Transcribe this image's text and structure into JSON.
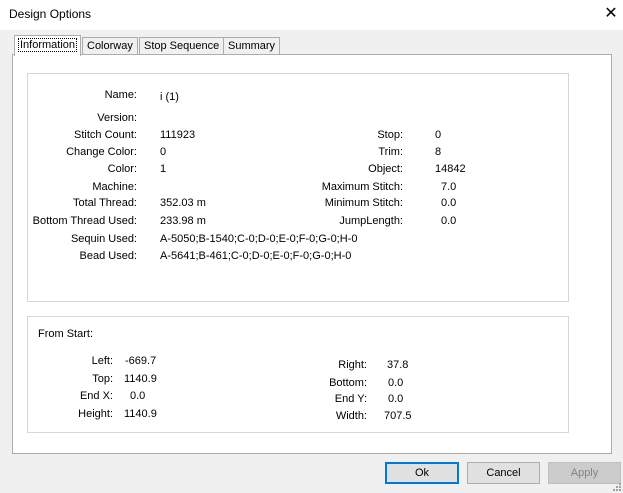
{
  "window": {
    "title": "Design Options"
  },
  "tabs": [
    "Information",
    "Colorway",
    "Stop Sequence",
    "Summary"
  ],
  "info": {
    "left": [
      {
        "label": "Name:",
        "value": "i (1)"
      },
      {
        "label": "Version:",
        "value": ""
      },
      {
        "label": "Stitch Count:",
        "value": "111923"
      },
      {
        "label": "Change Color:",
        "value": "0"
      },
      {
        "label": "Color:",
        "value": "1"
      },
      {
        "label": "Machine:",
        "value": ""
      },
      {
        "label": "Total Thread:",
        "value": "352.03 m"
      },
      {
        "label": "Bottom Thread Used:",
        "value": "233.98 m"
      },
      {
        "label": "Sequin Used:",
        "value": "A-5050;B-1540;C-0;D-0;E-0;F-0;G-0;H-0"
      },
      {
        "label": "Bead Used:",
        "value": "A-5641;B-461;C-0;D-0;E-0;F-0;G-0;H-0"
      }
    ],
    "right": [
      {
        "label": "Stop:",
        "value": "0"
      },
      {
        "label": "Trim:",
        "value": "8"
      },
      {
        "label": "Object:",
        "value": "14842"
      },
      {
        "label": "Maximum Stitch:",
        "value": "7.0"
      },
      {
        "label": "Minimum Stitch:",
        "value": "0.0"
      },
      {
        "label": "JumpLength:",
        "value": "0.0"
      }
    ]
  },
  "from_start": {
    "heading": "From Start:",
    "left": [
      {
        "label": "Left:",
        "value": "-669.7"
      },
      {
        "label": "Top:",
        "value": "1140.9"
      },
      {
        "label": "End X:",
        "value": "0.0"
      },
      {
        "label": "Height:",
        "value": "1140.9"
      }
    ],
    "right": [
      {
        "label": "Right:",
        "value": "37.8"
      },
      {
        "label": "Bottom:",
        "value": "0.0"
      },
      {
        "label": "End Y:",
        "value": "0.0"
      },
      {
        "label": "Width:",
        "value": "707.5"
      }
    ]
  },
  "buttons": {
    "ok": "Ok",
    "cancel": "Cancel",
    "apply": "Apply"
  }
}
